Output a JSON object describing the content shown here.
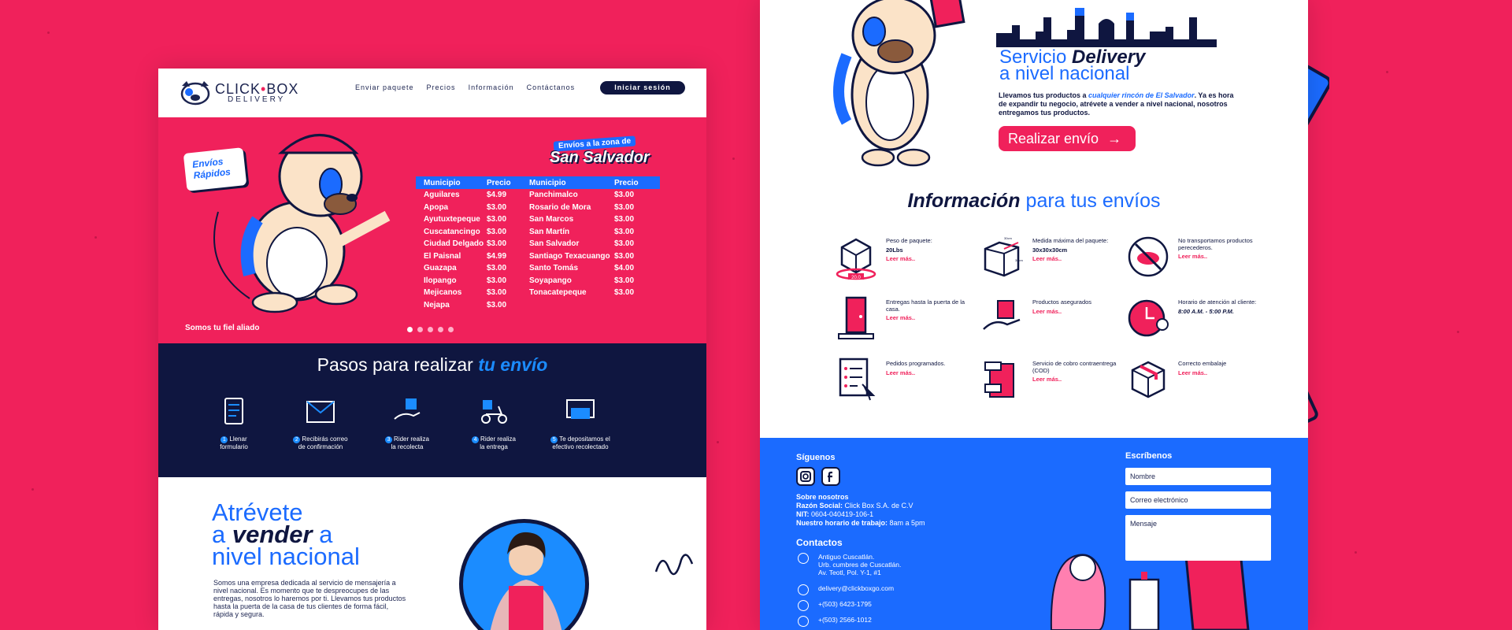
{
  "left": {
    "nav": {
      "logo_main": "CLICK",
      "logo_main2": "BOX",
      "logo_sub": "DELIVERY",
      "links": [
        "Enviar paquete",
        "Precios",
        "Información",
        "Contáctanos"
      ],
      "login": "Iniciar sesión"
    },
    "hero": {
      "badge_line1": "Envíos",
      "badge_line2": "Rápidos",
      "zone_line1": "Envíos a la zona de",
      "zone_line2": "San Salvador",
      "tagline": "Somos tu fiel aliado",
      "table": {
        "headers": [
          "Municipio",
          "Precio",
          "Municipio",
          "Precio"
        ],
        "rows": [
          [
            "Aguilares",
            "$4.99",
            "Panchimalco",
            "$3.00"
          ],
          [
            "Apopa",
            "$3.00",
            "Rosario de Mora",
            "$3.00"
          ],
          [
            "Ayutuxtepeque",
            "$3.00",
            "San Marcos",
            "$3.00"
          ],
          [
            "Cuscatancingo",
            "$3.00",
            "San Martín",
            "$3.00"
          ],
          [
            "Ciudad Delgado",
            "$3.00",
            "San Salvador",
            "$3.00"
          ],
          [
            "El Paisnal",
            "$4.99",
            "Santiago Texacuango",
            "$3.00"
          ],
          [
            "Guazapa",
            "$3.00",
            "Santo Tomás",
            "$4.00"
          ],
          [
            "Ilopango",
            "$3.00",
            "Soyapango",
            "$3.00"
          ],
          [
            "Mejicanos",
            "$3.00",
            "Tonacatepeque",
            "$3.00"
          ],
          [
            "Nejapa",
            "$3.00",
            "",
            ""
          ]
        ]
      },
      "carousel_active": 1
    },
    "steps": {
      "title_a": "Pasos para realizar",
      "title_b": "tu envío",
      "items": [
        {
          "n": "1",
          "l1": "Llenar",
          "l2": "formulario"
        },
        {
          "n": "2",
          "l1": "Recibirás correo",
          "l2": "de confirmación"
        },
        {
          "n": "3",
          "l1": "Rider realiza",
          "l2": "la recolecta"
        },
        {
          "n": "4",
          "l1": "Rider realiza",
          "l2": "la entrega"
        },
        {
          "n": "5",
          "l1": "Te depositamos el",
          "l2": "efectivo recolectado"
        }
      ]
    },
    "atrevete": {
      "l1": "Atrévete",
      "l2a": "a",
      "l2b": "vender",
      "l2c": "a",
      "l3": "nivel nacional",
      "body": "Somos una empresa dedicada al servicio de mensajería a nivel nacional. Es momento que te despreocupes de las entregas, nosotros lo haremos por ti. Llevamos tus productos hasta la puerta de la casa de tus clientes de forma fácil, rápida y segura."
    }
  },
  "right": {
    "service": {
      "title_a": "Servicio",
      "title_b": "Delivery",
      "title_c": "a nivel nacional",
      "body_a": "Llevamos tus productos a",
      "body_em": "cualquier rincón de El Salvador",
      "body_b": ". Ya es hora de expandir tu negocio, atrévete a vender a nivel nacional, nosotros entregamos tus productos.",
      "button": "Realizar envío"
    },
    "info": {
      "title_a": "Información",
      "title_b": "para tus envíos",
      "weight_badge": "20.0",
      "dim_30a": "30cm",
      "dim_30b": "30cm",
      "read_more": "Leer más..",
      "items": [
        {
          "l": "Peso de paquete:",
          "v": "20Lbs",
          "more": true
        },
        {
          "l": "Medida máxima del paquete:",
          "v": "30x30x30cm",
          "more": true
        },
        {
          "l": "No transportamos productos perecederos.",
          "v": "",
          "more": true
        },
        {
          "l": "Entregas hasta la puerta de la casa.",
          "v": "",
          "more": true
        },
        {
          "l": "Productos asegurados",
          "v": "",
          "more": true
        },
        {
          "l": "Horario de atención al cliente:",
          "v": "8:00 A.M. - 5:00 P.M.",
          "more": false
        },
        {
          "l": "Pedidos programados.",
          "v": "",
          "more": true
        },
        {
          "l": "Servicio de cobro contraentrega (COD)",
          "v": "",
          "more": true
        },
        {
          "l": "Correcto embalaje",
          "v": "",
          "more": true
        }
      ]
    },
    "footer": {
      "follow": "Síguenos",
      "about_title": "Sobre nosotros",
      "razon_label": "Razón Social:",
      "razon": "Click Box S.A. de C.V",
      "nit_label": "NIT:",
      "nit": "0604-040419-106-1",
      "horario_label": "Nuestro horario de trabajo:",
      "horario": "8am a 5pm",
      "contacts_title": "Contactos",
      "address1": "Antiguo Cuscatlán.",
      "address2": "Urb. cumbres de Cuscatlán.",
      "address3": "Av. Teotl, Pol. Y-1, #1",
      "email": "delivery@clickboxgo.com",
      "phone1": "+(503) 6423-1795",
      "phone2": "+(503) 2566-1012",
      "write": "Escríbenos",
      "name_ph": "Nombre",
      "email_ph": "Correo electrónico",
      "msg_ph": "Mensaje"
    }
  },
  "colors": {
    "pink": "#f0215b",
    "navy": "#0f1640",
    "blue": "#1b6bff"
  }
}
